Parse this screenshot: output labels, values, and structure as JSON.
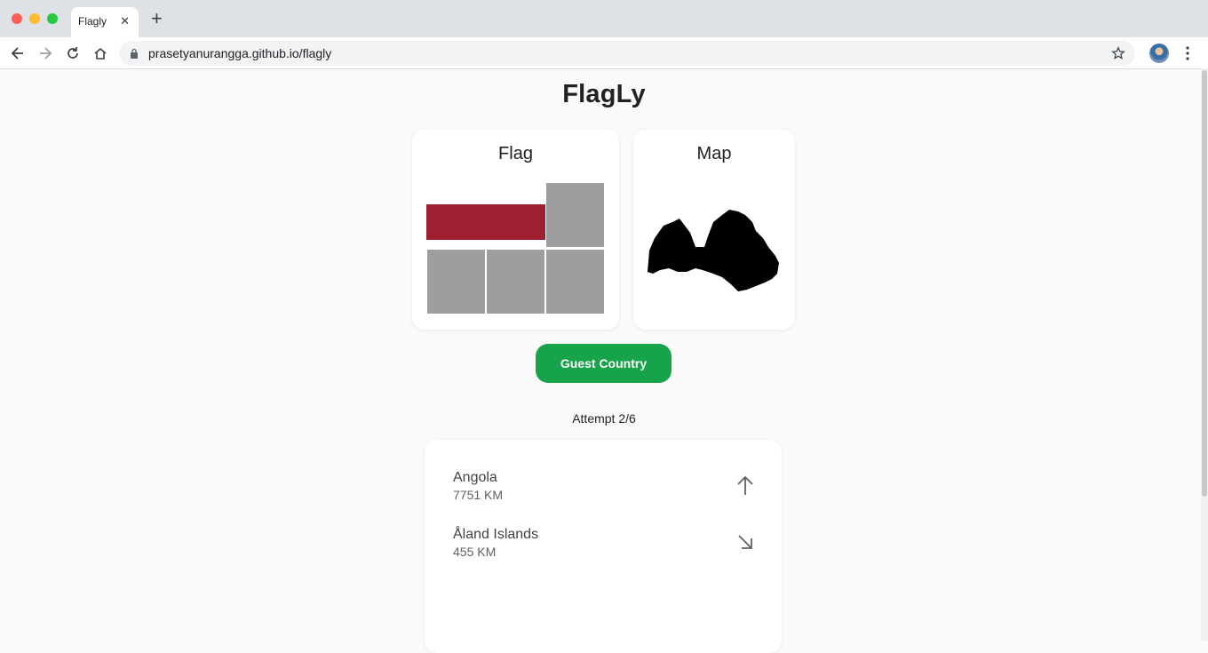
{
  "browser": {
    "tab_title": "Flagly",
    "tab_close": "✕",
    "new_tab": "+",
    "url": "prasetyanurangga.github.io/flagly"
  },
  "page": {
    "title": "FlagLy",
    "flag_card": {
      "title": "Flag",
      "bar_color": "#9e1f32",
      "tile_color": "#9e9e9e"
    },
    "map_card": {
      "title": "Map"
    },
    "guess_button": "Guest Country",
    "attempt": "Attempt 2/6",
    "guesses": [
      {
        "country": "Angola",
        "distance": "7751 KM",
        "direction": "arrow-up-icon"
      },
      {
        "country": "Åland Islands",
        "distance": "455 KM",
        "direction": "arrow-down-right-icon"
      }
    ]
  },
  "colors": {
    "button": "#17a34a",
    "background": "#fafafa"
  }
}
